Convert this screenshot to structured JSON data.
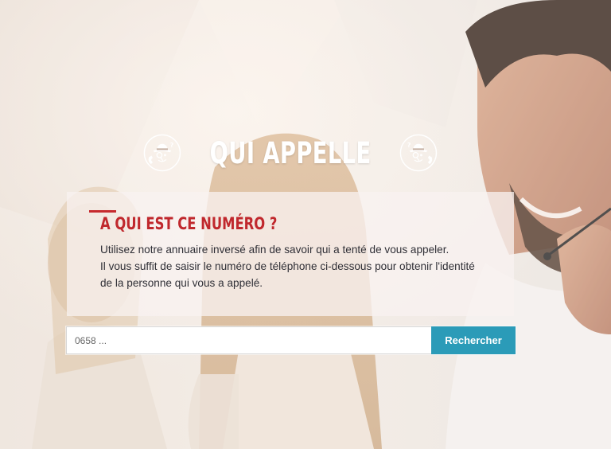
{
  "header": {
    "title": "QUI APPELLE",
    "logo_icon": "detective-phone-icon"
  },
  "card": {
    "heading": "A QUI EST CE NUMÉRO ?",
    "line1": "Utilisez notre annuaire inversé afin de savoir qui a tenté de vous appeler.",
    "line2": "Il vous suffit de saisir le numéro de téléphone ci-dessous pour obtenir l'identité",
    "line3": "de la personne qui vous a appelé."
  },
  "search": {
    "placeholder": "0658 ...",
    "value": "",
    "button_label": "Rechercher"
  },
  "colors": {
    "accent_red": "#c0282d",
    "button_teal": "#2b9bb8",
    "title_white": "#ffffff"
  }
}
